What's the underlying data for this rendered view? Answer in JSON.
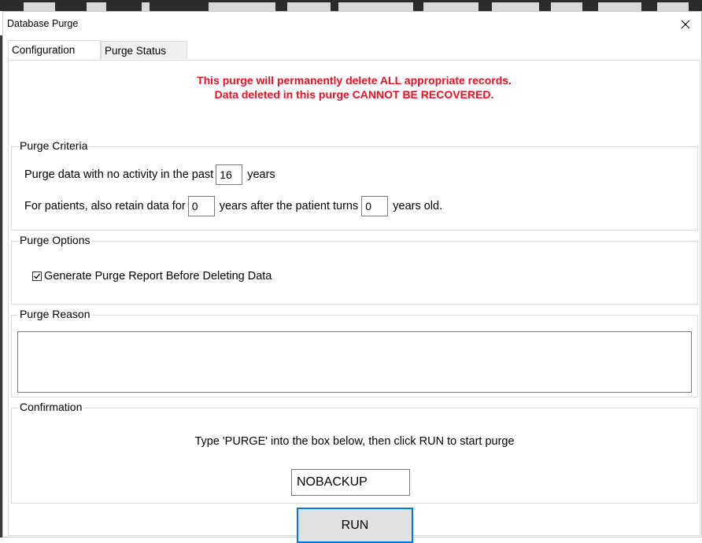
{
  "window": {
    "title": "Database Purge"
  },
  "tabs": [
    {
      "label": "Configuration",
      "active": true
    },
    {
      "label": "Purge Status",
      "active": false
    }
  ],
  "warning": {
    "line1": "This purge will permanently delete ALL appropriate records.",
    "line2": "Data deleted in this purge CANNOT BE RECOVERED.",
    "color": "#e81123"
  },
  "criteria": {
    "title": "Purge Criteria",
    "row1_prefix": "Purge data with no activity in the past",
    "row1_value": "16",
    "row1_suffix": "years",
    "row2_prefix": "For patients, also retain data for",
    "row2_value1": "0",
    "row2_middle": "years after the patient turns",
    "row2_value2": "0",
    "row2_suffix": "years old."
  },
  "options": {
    "title": "Purge Options",
    "generate_report_label": "Generate Purge Report Before Deleting Data",
    "generate_report_checked": true
  },
  "reason": {
    "title": "Purge Reason",
    "value": ""
  },
  "confirmation": {
    "title": "Confirmation",
    "instruction": "Type 'PURGE' into the box below, then click RUN to start purge",
    "value": "NOBACKUP"
  },
  "run_button": {
    "label": "RUN",
    "accent_color": "#0078d7"
  }
}
